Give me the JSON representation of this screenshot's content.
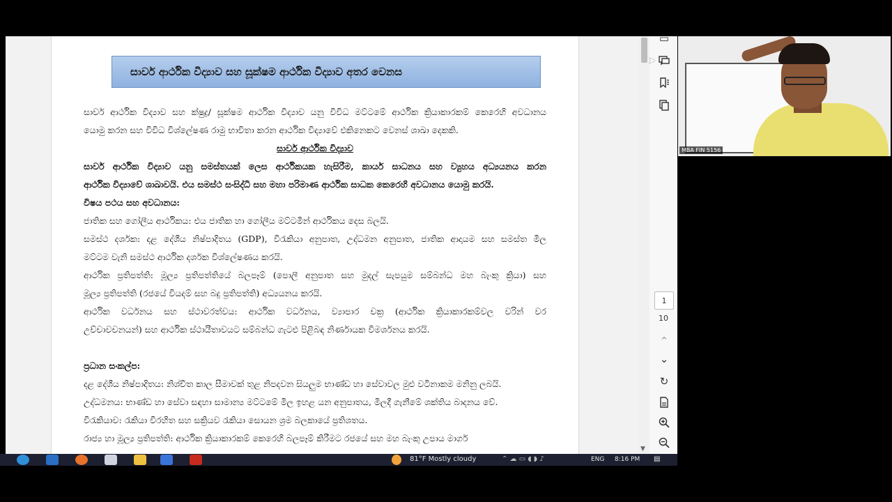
{
  "document": {
    "title": "සාර්ව ආර්ථික විද්‍යාව සහ සූක්ෂම ආර්ථික විද්‍යාව අතර වෙනස",
    "intro_lines": [
      "සාර්ව ආර්ථික විද්‍යාව සහ ක්ෂුද්‍ර/ සූක්ෂම ආර්ථික විද්‍යාව යනු විවිධ මට්ටමේ ආර්ථික ක්‍රියාකාරකම් කෙරෙහි අවධානය",
      "යොමු කරන සහ විවිධ විශ්ලේෂණ රාමු භාවිතා කරන ආර්ථික විද්‍යාවේ එකිනෙකට වෙනස් ශාඛා දෙකකි."
    ],
    "section_heading": "සාර්ව ආර්ථික විද්‍යාව",
    "def_lines": [
      "සාර්ව ආර්ථික විද්‍යාව යනු සමස්තයක් ලෙස ආර්ථිකයක හැසිරීම, කාර්ය සාධනය සහ ව්‍යුහය අධ්‍යයනය කරන",
      "ආර්ථික විද්‍යාවේ ශාඛාවයි. එය සමස්ථ සංසිද්ධි සහ මහා පරිමාණ ආර්ථික සාධක කෙරෙහි අවධානය යොමු කරයි."
    ],
    "scope_heading": "විෂය පථය සහ අවධානය:",
    "scope_lines": [
      "ජාතික සහ ගෝලීය ආර්ථිකය: එය ජාතික හා ගෝලීය මට්ටමින් ආර්ථිකය දෙස බලයි.",
      "සමස්ථ දර්ශක: දළ දේශීය නිෂ්පාදිතය (GDP), විරැකියා අනුපාත, උද්ධමන අනුපාත, ජාතික ආදායම සහ සමස්ත මිල",
      "මට්ටම වැනි සමස්ථ ආර්ථික දර්ශක විශ්ලේෂණය කරයි.",
      "ආර්ථික ප්‍රතිපත්ති: මූල්‍ය ප්‍රතිපත්තියේ බලපෑම් (පොලී අනුපාත සහ මුදල් සැපයුම සම්බන්ධ මහ බැංකු ක්‍රියා) සහ",
      "මූල්‍ය ප්‍රතිපත්ති (රජයේ වියදම් සහ බදු ප්‍රතිපත්ති) අධ්‍යයනය කරයි.",
      "ආර්ථික වර්ධනය සහ ස්ථාවරත්වය: ආර්ථික වර්ධනය, ව්‍යාපාර චක්‍ර (ආර්ථික ක්‍රියාකාරකම්වල වරින් වර",
      "උච්චාවචනයන්) සහ ආර්ථික ස්ථායීතාවයට සම්බන්ධ ගැටළු පිළිබඳ නිර්ණායක විමර්ශනය කරයි."
    ],
    "concepts_heading": "ප්‍රධාන සංකල්ප:",
    "concept_lines": [
      "දළ දේශීය නිෂ්පාදිතය: නිශ්චිත කාල සීමාවක් තුළ නිපදවන සියලුම භාණ්ඩ හා සේවාවල මුළු වටිනාකම මනිනු ලබයි.",
      "උද්ධමනය: භාණ්ඩ හා සේවා සඳහා සාමාන්‍ය මට්ටමේ මිල ඉහළ යන අනුපාතය, මිලදී ගැනීමේ ශක්තිය බාදනය වේ.",
      "විරැකියාව: රැකියා විරහිත සහ සක්‍රියව රැකියා සොයන ශ්‍රම බලකායේ ප්‍රතිශතය.",
      "රාජ්‍ය හා මූල්‍ය ප්‍රතිපත්ති: ආර්ථික ක්‍රියාකාරකම් කෙරෙහි බලපෑම් කිරීමට රජයේ සහ මහ බැංකු උපාය මාර්ග"
    ]
  },
  "viewer": {
    "current_page": "1",
    "total_pages": "10",
    "icons": [
      "comment-icon",
      "bookmark-icon",
      "copy-icon",
      "chevron-up-icon",
      "chevron-down-icon",
      "rotate-icon",
      "save-icon",
      "zoom-in-icon",
      "zoom-out-icon"
    ]
  },
  "video": {
    "participant_label": "MBA FIN 5156"
  },
  "taskbar": {
    "weather": "81°F  Mostly cloudy",
    "language": "ENG",
    "time": "8:16 PM"
  }
}
